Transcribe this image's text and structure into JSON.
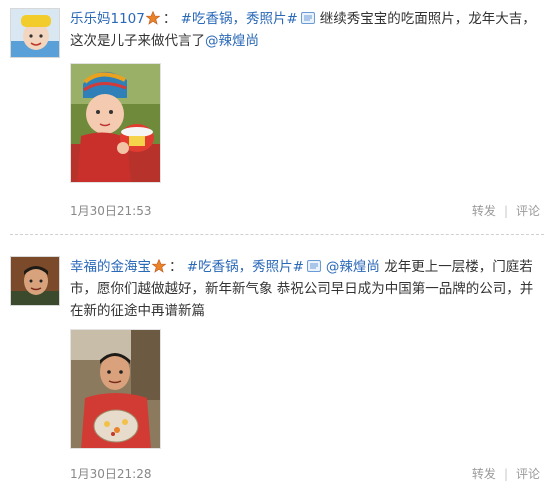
{
  "posts": [
    {
      "username": "乐乐妈1107",
      "colon": "：",
      "topic": "#吃香锅，秀照片#",
      "body_before": "继续秀宝宝的吃面照片，龙年大吉，这次是儿子来做代言了",
      "mention": "@辣煌尚",
      "body_after": "",
      "time": "1月30日21:53",
      "repost_label": "转发",
      "separator": "|",
      "comment_label": "评论"
    },
    {
      "username": "幸福的金海宝",
      "colon": "：",
      "topic": "#吃香锅，秀照片#",
      "body_before": "",
      "mention": "@辣煌尚",
      "body_after": "龙年更上一层楼，门庭若市，愿你们越做越好，新年新气象 恭祝公司早日成为中国第一品牌的公司，并在新的征途中再谱新篇",
      "time": "1月30日21:28",
      "repost_label": "转发",
      "separator": "|",
      "comment_label": "评论"
    }
  ],
  "colors": {
    "link": "#2a68b8",
    "meta": "#9a9a9a",
    "badge": "#e8832a"
  },
  "icons": {
    "badge": "star-badge-icon",
    "topic": "topic-bubble-icon"
  }
}
